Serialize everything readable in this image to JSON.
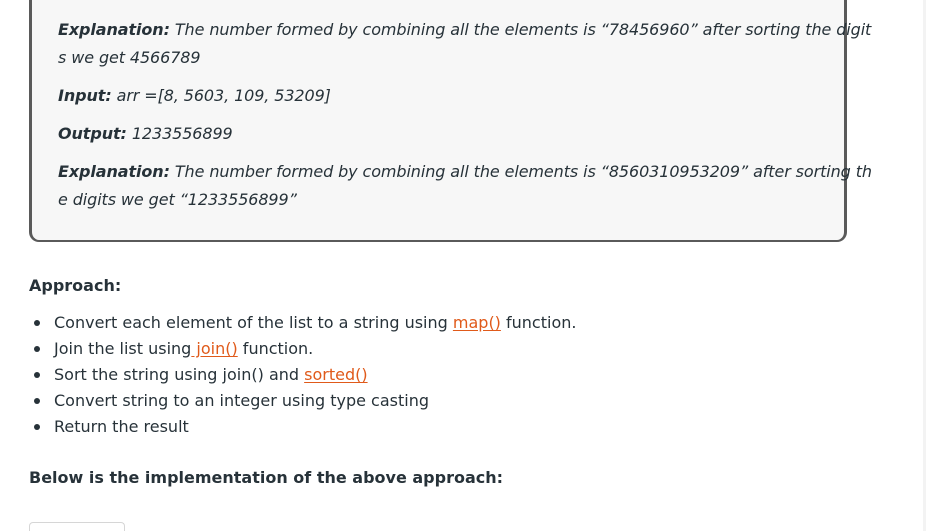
{
  "example": {
    "explanation1": {
      "label": "Explanation:",
      "line1": " The number formed by combining all the elements is “78456960” after sorting the digit",
      "line2": "s we get 4566789"
    },
    "input": {
      "label": "Input:",
      "value": " arr =[8, 5603, 109, 53209]"
    },
    "output": {
      "label": "Output:",
      "value": " 1233556899"
    },
    "explanation2": {
      "label": "Explanation:",
      "line1": " The number formed by combining all the elements is “8560310953209” after sorting th",
      "line2": "e digits we get “1233556899”"
    }
  },
  "approach": {
    "heading": "Approach:",
    "steps": [
      {
        "before": "Convert each element of the list to a string using ",
        "link": "map()",
        "after": " function."
      },
      {
        "before": "Join the list using",
        "link": " join()",
        "after": " function."
      },
      {
        "before": "Sort the string using join() and ",
        "link": "sorted()",
        "after": ""
      },
      {
        "before": "Convert string to an integer using type casting",
        "link": "",
        "after": ""
      },
      {
        "before": "Return the result",
        "link": "",
        "after": ""
      }
    ]
  },
  "implementation": {
    "heading": "Below is the implementation of the above approach:"
  }
}
